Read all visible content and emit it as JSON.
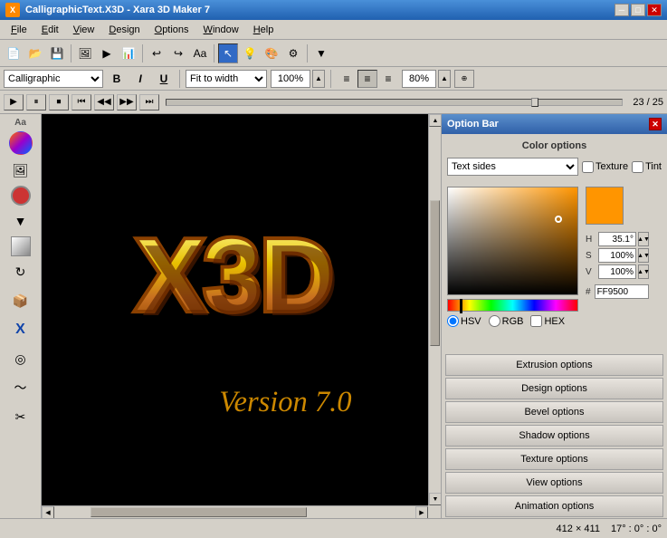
{
  "title_bar": {
    "icon_text": "X",
    "title": "CalligraphicText.X3D - Xara 3D Maker 7",
    "min_btn": "─",
    "max_btn": "□",
    "close_btn": "✕"
  },
  "menu": {
    "items": [
      "File",
      "Edit",
      "View",
      "Design",
      "Options",
      "Window",
      "Help"
    ]
  },
  "format_bar": {
    "font": "Calligraphic",
    "bold": "B",
    "italic": "I",
    "underline": "U",
    "fit_to": "Fit to width",
    "zoom": "100%",
    "zoom_pct": "80%"
  },
  "playback": {
    "frame_counter": "23 / 25"
  },
  "right_panel": {
    "header": "Option Bar",
    "close": "✕",
    "color_section_title": "Color options",
    "dropdown_value": "Text sides",
    "texture_label": "Texture",
    "tint_label": "Tint",
    "hsv_label": "HSV",
    "rgb_label": "RGB",
    "hex_label": "HEX",
    "h_label": "H",
    "s_label": "S",
    "v_label": "V",
    "h_value": "35.1°",
    "s_value": "100%",
    "v_value": "100%",
    "hex_value": "FF9500",
    "option_btns": [
      "Extrusion options",
      "Design options",
      "Bevel options",
      "Shadow options",
      "Texture options",
      "View options",
      "Animation options"
    ]
  },
  "status_bar": {
    "dimensions": "412 × 411",
    "rotation": "17° : 0° : 0°"
  }
}
